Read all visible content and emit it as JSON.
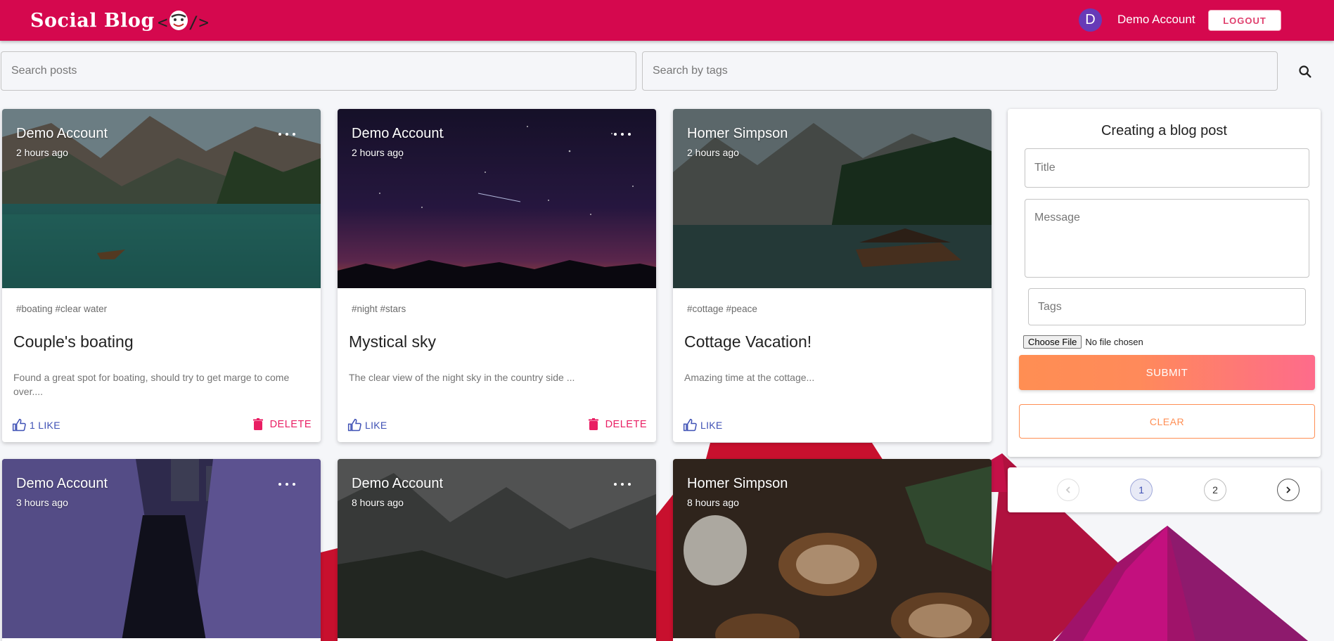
{
  "header": {
    "brand": "Social Blog",
    "avatar_letter": "D",
    "user_name": "Demo Account",
    "logout_label": "LOGOUT"
  },
  "search": {
    "posts_placeholder": "Search posts",
    "tags_placeholder": "Search by tags",
    "search_icon": "search-icon"
  },
  "posts": [
    {
      "author": "Demo Account",
      "time": "2 hours ago",
      "tags": "#boating #clear water",
      "title": "Couple's boating",
      "message": "Found a great spot for boating, should try to get marge to come over....",
      "like_label": "1 LIKE",
      "delete_label": "DELETE"
    },
    {
      "author": "Demo Account",
      "time": "2 hours ago",
      "tags": "#night #stars",
      "title": "Mystical sky",
      "message": "The clear view of the night sky in the country side ...",
      "like_label": "LIKE",
      "delete_label": "DELETE"
    },
    {
      "author": "Homer Simpson",
      "time": "2 hours ago",
      "tags": "#cottage #peace",
      "title": "Cottage Vacation!",
      "message": "Amazing time at the cottage...",
      "like_label": "LIKE"
    },
    {
      "author": "Demo Account",
      "time": "3 hours ago"
    },
    {
      "author": "Demo Account",
      "time": "8 hours ago"
    },
    {
      "author": "Homer Simpson",
      "time": "8 hours ago"
    }
  ],
  "form": {
    "title": "Creating a blog post",
    "title_placeholder": "Title",
    "message_placeholder": "Message",
    "tags_placeholder": "Tags",
    "choose_file_label": "Choose File",
    "no_file_label": "No file chosen",
    "submit_label": "SUBMIT",
    "clear_label": "CLEAR"
  },
  "pagination": {
    "pages": [
      "1",
      "2"
    ],
    "current": "1"
  },
  "colors": {
    "appbar": "#d5084e",
    "accent_like": "#3f51b5",
    "accent_delete": "#e91e63",
    "submit_gradient_start": "#ff8e53",
    "submit_gradient_end": "#fe6b8b"
  }
}
